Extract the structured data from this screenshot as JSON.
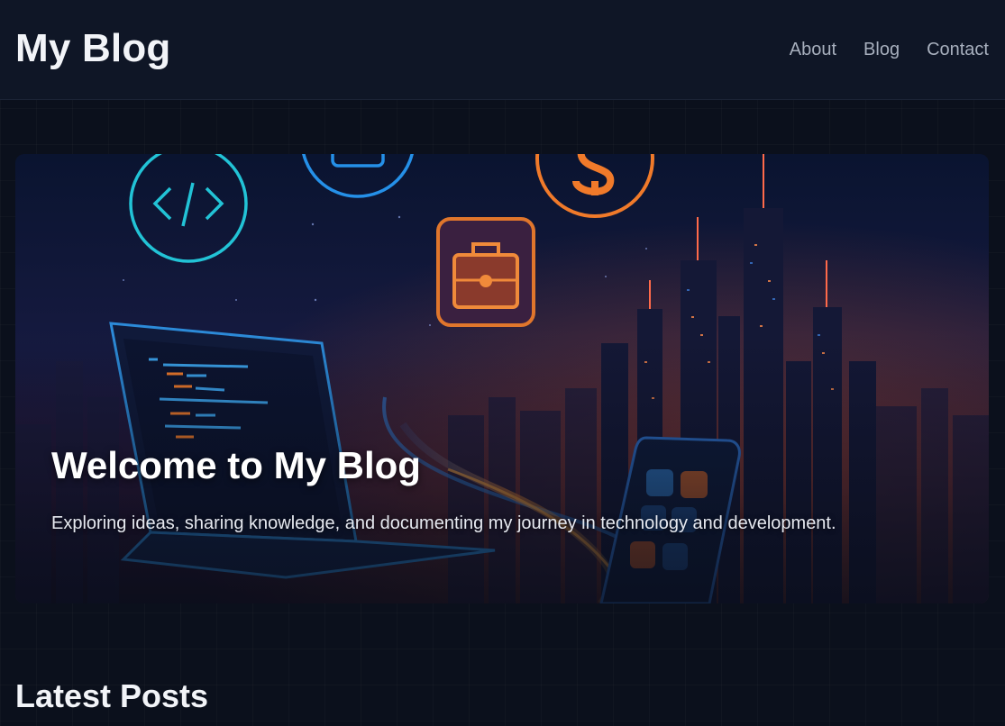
{
  "site": {
    "title": "My Blog"
  },
  "nav": {
    "items": [
      {
        "label": "About"
      },
      {
        "label": "Blog"
      },
      {
        "label": "Contact"
      }
    ]
  },
  "hero": {
    "title": "Welcome to My Blog",
    "subtitle": "Exploring ideas, sharing knowledge, and documenting my journey in technology and development.",
    "icons": [
      "code-icon",
      "briefcase-icon",
      "dollar-icon",
      "laptop-icon",
      "phone-icon",
      "city-skyline"
    ]
  },
  "latest": {
    "title": "Latest Posts"
  },
  "colors": {
    "background": "#0b101c",
    "header": "#0f1626",
    "accent_cyan": "#22c3d6",
    "accent_orange": "#f07a2a"
  }
}
